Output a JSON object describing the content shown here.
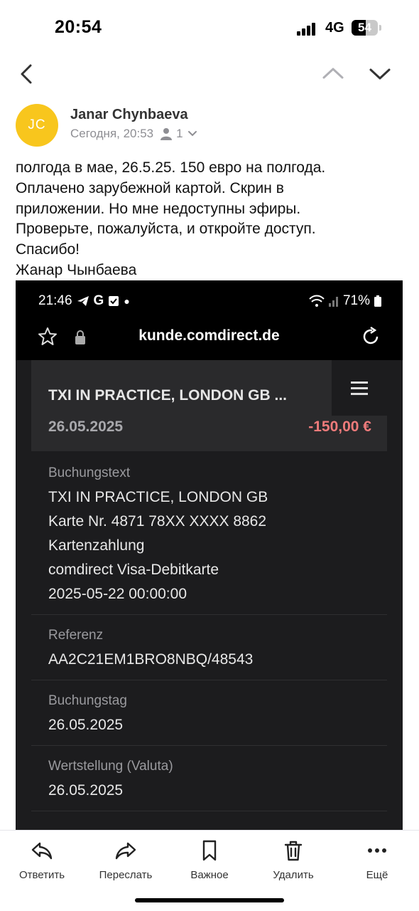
{
  "status_bar": {
    "time": "20:54",
    "network": "4G",
    "battery": "54",
    "battery_level": 0.54
  },
  "sender": {
    "initials": "JC",
    "name": "Janar Chynbaeva",
    "date": "Сегодня, 20:53",
    "recipients_count": "1",
    "avatar_color": "#f8c61d"
  },
  "body": {
    "lines": [
      "полгода в мае, 26.5.25. 150 евро на полгода.",
      "Оплачено зарубежной картой. Скрин в",
      "приложении. Но мне недоступны эфиры.",
      "Проверьте,  пожалуйста,  и откройте доступ.",
      "Спасибо!",
      "Жанар Чынбаева"
    ]
  },
  "attachment": {
    "status_time": "21:46",
    "status_battery": "71%",
    "url": "kunde.comdirect.de",
    "transaction": {
      "title": "TXI IN PRACTICE, LONDON GB ...",
      "date": "26.05.2025",
      "amount": "-150,00 €",
      "amount_color": "#ef7b7b"
    },
    "fields": {
      "buchungstext_label": "Buchungstext",
      "buchungstext_lines": [
        "TXI IN PRACTICE, LONDON GB",
        "Karte Nr. 4871 78XX XXXX 8862",
        "Kartenzahlung",
        "comdirect Visa-Debitkarte",
        "2025-05-22 00:00:00"
      ],
      "referenz_label": "Referenz",
      "referenz_value": "AA2C21EM1BRO8NBQ/48543",
      "buchungstag_label": "Buchungstag",
      "buchungstag_value": "26.05.2025",
      "wertstellung_label": "Wertstellung (Valuta)",
      "wertstellung_value": "26.05.2025"
    }
  },
  "toolbar": {
    "reply": "Ответить",
    "forward": "Переслать",
    "important": "Важное",
    "delete": "Удалить",
    "more": "Ещё"
  },
  "icons": {
    "back": "chevron-left-icon",
    "prev": "chevron-up-icon",
    "next": "chevron-down-icon",
    "reply": "reply-icon",
    "forward": "forward-icon",
    "important": "bookmark-icon",
    "delete": "trash-icon",
    "more": "more-dots-icon"
  }
}
